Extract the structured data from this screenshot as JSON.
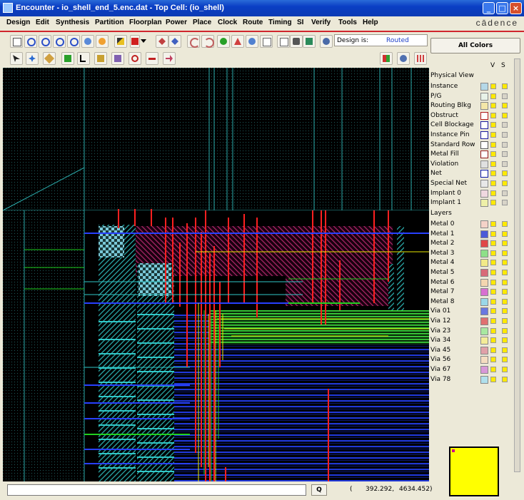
{
  "window": {
    "title": "Encounter - io_shell_end_5.enc.dat - Top Cell: (io_shell)",
    "controls": [
      "_",
      "□",
      "×"
    ]
  },
  "menu": [
    "Design",
    "Edit",
    "Synthesis",
    "Partition",
    "Floorplan",
    "Power",
    "Place",
    "Clock",
    "Route",
    "Timing",
    "SI",
    "Verify",
    "Tools",
    "Help"
  ],
  "brand": "cādence",
  "toolbar": {
    "design_is_label": "Design is:",
    "design_is_value": "Routed",
    "row1_icons": [
      "new-file-icon",
      "zoom-in-icon",
      "zoom-out-icon",
      "zoom-area-icon",
      "zoom-fit-icon",
      "redraw-icon",
      "refresh-icon",
      "edit-icon",
      "color-palette-icon",
      "dropdown-arrow-icon",
      "move-icon",
      "swap-icon",
      "undo-icon",
      "redo-icon",
      "globe-icon",
      "hierarchy-icon",
      "info-icon",
      "blank-page-icon",
      "notes-icon",
      "camera-icon",
      "screenshot-icon",
      "settings-icon"
    ],
    "row2_icons": [
      "select-arrow-icon",
      "pan-icon",
      "ruler-icon",
      "green-box-icon",
      "wire-icon",
      "add-icon",
      "highlight-icon",
      "cut-icon",
      "split-icon",
      "merge-icon"
    ],
    "right_icons": [
      "layer-map-icon",
      "search-net-icon",
      "display-grid-icon"
    ]
  },
  "panel": {
    "all_colors": "All Colors",
    "col_v": "V",
    "col_s": "S",
    "physical_view_label": "Physical View",
    "physical_view": [
      {
        "label": "Instance",
        "color": "#b5d8e8",
        "s": true
      },
      {
        "label": "P/G",
        "color": "#e8f2e8",
        "s": false
      },
      {
        "label": "Routing Blkg",
        "color": "#f4e7a8",
        "s": true
      },
      {
        "label": "Obstruct",
        "color": "#ffffff",
        "border": "#b01818",
        "s": true
      },
      {
        "label": "Cell Blockage",
        "color": "#ffffff",
        "border": "#1a1aa0",
        "s": false
      },
      {
        "label": "Instance Pin",
        "color": "#ffffff",
        "border": "#1a1aa0",
        "s": false
      },
      {
        "label": "Standard Row",
        "color": "#ffffff",
        "border": "#555555",
        "s": false
      },
      {
        "label": "Metal Fill",
        "color": "#ffffff",
        "border": "#901818",
        "s": false
      },
      {
        "label": "Violation",
        "color": "#e0e0e0",
        "s": false
      },
      {
        "label": "Net",
        "color": "#ffffff",
        "border": "#0a18a8",
        "s": true
      },
      {
        "label": "Special Net",
        "color": "#e8e8e8",
        "s": true
      },
      {
        "label": "Implant 0",
        "color": "#f0d8e0",
        "s": false
      },
      {
        "label": "Implant 1",
        "color": "#eef0a8",
        "s": false
      }
    ],
    "layers_label": "Layers",
    "layers": [
      {
        "label": "Metal 0",
        "color": "#f4d2c8"
      },
      {
        "label": "Metal 1",
        "color": "#4a5ad8"
      },
      {
        "label": "Metal 2",
        "color": "#e04848"
      },
      {
        "label": "Metal 3",
        "color": "#8ee088"
      },
      {
        "label": "Metal 4",
        "color": "#f2ea88"
      },
      {
        "label": "Metal 5",
        "color": "#d86a78"
      },
      {
        "label": "Metal 6",
        "color": "#f4d6b0"
      },
      {
        "label": "Metal 7",
        "color": "#d870d0"
      },
      {
        "label": "Metal 8",
        "color": "#9ad8e8"
      },
      {
        "label": "Via 01",
        "color": "#6a78e0"
      },
      {
        "label": "Via 12",
        "color": "#e07070"
      },
      {
        "label": "Via 23",
        "color": "#a8e8a0"
      },
      {
        "label": "Via 34",
        "color": "#f4ec98"
      },
      {
        "label": "Via 45",
        "color": "#e0a0a8"
      },
      {
        "label": "Via 56",
        "color": "#f4dcc0"
      },
      {
        "label": "Via 67",
        "color": "#d898d8"
      },
      {
        "label": "Via 78",
        "color": "#b0e0ec"
      }
    ]
  },
  "status": {
    "command_value": "",
    "q_label": "Q",
    "coord_open": "(",
    "coord_x": "392.292,",
    "coord_y": "4634.452)"
  },
  "colors": {
    "metal1": "#2840ff",
    "metal2": "#ff2020",
    "metal3": "#20d020",
    "metal4": "#e8e800",
    "metal5": "#c03060",
    "metal8": "#30c8c8",
    "cell_border": "#30c0c0"
  }
}
